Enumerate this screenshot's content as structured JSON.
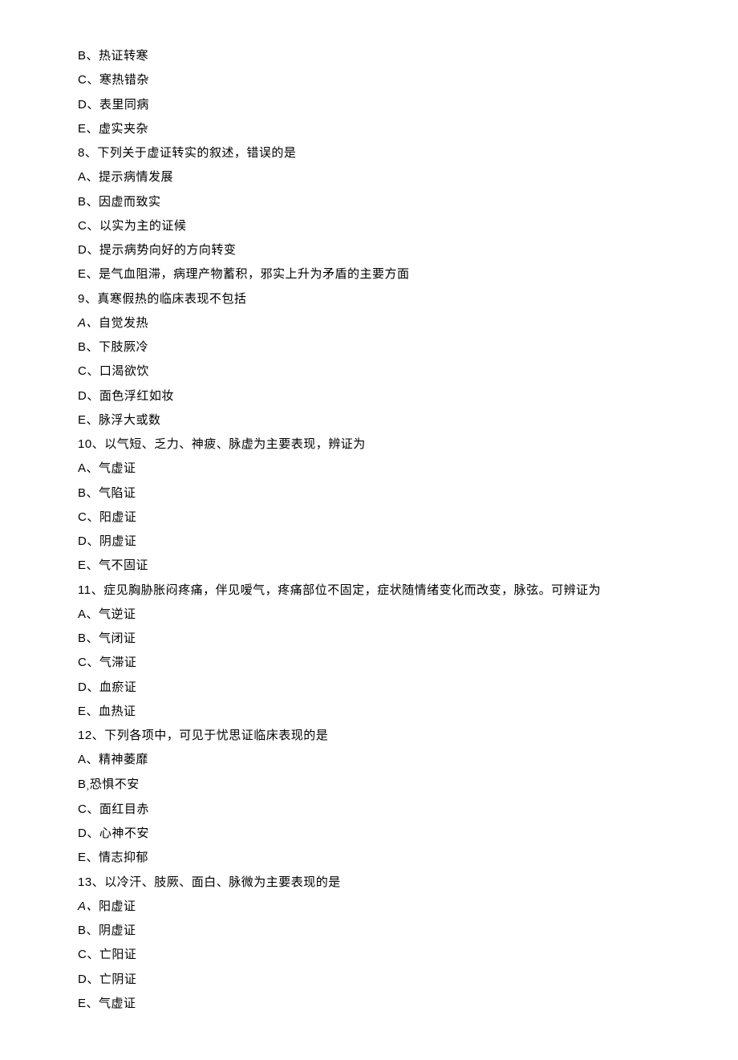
{
  "lines": [
    {
      "id": "q7-b",
      "type": "option",
      "prefix": "B、",
      "text": "热证转寒"
    },
    {
      "id": "q7-c",
      "type": "option",
      "prefix": "C、",
      "text": "寒热错杂"
    },
    {
      "id": "q7-d",
      "type": "option",
      "prefix": "D、",
      "text": "表里同病"
    },
    {
      "id": "q7-e",
      "type": "option",
      "prefix": "E、",
      "text": "虚实夹杂"
    },
    {
      "id": "q8",
      "type": "question",
      "prefix": "8、",
      "text": "下列关于虚证转实的叙述，错误的是"
    },
    {
      "id": "q8-a",
      "type": "option",
      "prefix": "A、",
      "text": "提示病情发展"
    },
    {
      "id": "q8-b",
      "type": "option",
      "prefix": "B、",
      "text": "因虚而致实"
    },
    {
      "id": "q8-c",
      "type": "option",
      "prefix": "C、",
      "text": "以实为主的证候"
    },
    {
      "id": "q8-d",
      "type": "option",
      "prefix": "D、",
      "text": "提示病势向好的方向转变"
    },
    {
      "id": "q8-e",
      "type": "option",
      "prefix": "E、",
      "text": "是气血阻滞，病理产物蓄积，邪实上升为矛盾的主要方面"
    },
    {
      "id": "q9",
      "type": "question",
      "prefix": "9、",
      "text": "真寒假热的临床表现不包括"
    },
    {
      "id": "q9-a",
      "type": "option-italic",
      "prefix": "A、",
      "text": "自觉发热"
    },
    {
      "id": "q9-b",
      "type": "option",
      "prefix": "B、",
      "text": "下肢厥冷"
    },
    {
      "id": "q9-c",
      "type": "option",
      "prefix": "C、",
      "text": "口渴欲饮"
    },
    {
      "id": "q9-d",
      "type": "option",
      "prefix": "D、",
      "text": "面色浮红如妆"
    },
    {
      "id": "q9-e",
      "type": "option",
      "prefix": "E、",
      "text": "脉浮大或数"
    },
    {
      "id": "q10",
      "type": "question",
      "prefix": "10、",
      "text": "以气短、乏力、神疲、脉虚为主要表现，辨证为"
    },
    {
      "id": "q10-a",
      "type": "option",
      "prefix": "A、",
      "text": "气虚证"
    },
    {
      "id": "q10-b",
      "type": "option",
      "prefix": "B、",
      "text": "气陷证"
    },
    {
      "id": "q10-c",
      "type": "option",
      "prefix": "C、",
      "text": "阳虚证"
    },
    {
      "id": "q10-d",
      "type": "option",
      "prefix": "D、",
      "text": "阴虚证"
    },
    {
      "id": "q10-e",
      "type": "option",
      "prefix": "E、",
      "text": "气不固证"
    },
    {
      "id": "q11",
      "type": "question",
      "prefix": "11、",
      "text": "症见胸胁胀闷疼痛，伴见嗳气，疼痛部位不固定，症状随情绪变化而改变，脉弦。可辨证为"
    },
    {
      "id": "q11-a",
      "type": "option",
      "prefix": "A、",
      "text": "气逆证"
    },
    {
      "id": "q11-b",
      "type": "option",
      "prefix": "B、",
      "text": "气闭证"
    },
    {
      "id": "q11-c",
      "type": "option",
      "prefix": "C、",
      "text": "气滞证"
    },
    {
      "id": "q11-d",
      "type": "option",
      "prefix": "D、",
      "text": "血瘀证"
    },
    {
      "id": "q11-e",
      "type": "option",
      "prefix": "E、",
      "text": "血热证"
    },
    {
      "id": "q12",
      "type": "question",
      "prefix": "12、",
      "text": "下列各项中，可见于忧思证临床表现的是"
    },
    {
      "id": "q12-a",
      "type": "option",
      "prefix": "A、",
      "text": "精神萎靡"
    },
    {
      "id": "q12-b",
      "type": "option-sub",
      "prefix": "B",
      "sub": "›",
      "text": "恐惧不安"
    },
    {
      "id": "q12-c",
      "type": "option",
      "prefix": "C、",
      "text": "面红目赤"
    },
    {
      "id": "q12-d",
      "type": "option",
      "prefix": "D、",
      "text": "心神不安"
    },
    {
      "id": "q12-e",
      "type": "option",
      "prefix": "E、",
      "text": "情志抑郁"
    },
    {
      "id": "q13",
      "type": "question",
      "prefix": "13、",
      "text": "以冷汗、肢厥、面白、脉微为主要表现的是"
    },
    {
      "id": "q13-a",
      "type": "option-italic",
      "prefix": "A、",
      "text": "阳虚证"
    },
    {
      "id": "q13-b",
      "type": "option",
      "prefix": "B、",
      "text": "阴虚证"
    },
    {
      "id": "q13-c",
      "type": "option",
      "prefix": "C、",
      "text": "亡阳证"
    },
    {
      "id": "q13-d",
      "type": "option",
      "prefix": "D、",
      "text": "亡阴证"
    },
    {
      "id": "q13-e",
      "type": "option",
      "prefix": "E、",
      "text": "气虚证"
    }
  ]
}
